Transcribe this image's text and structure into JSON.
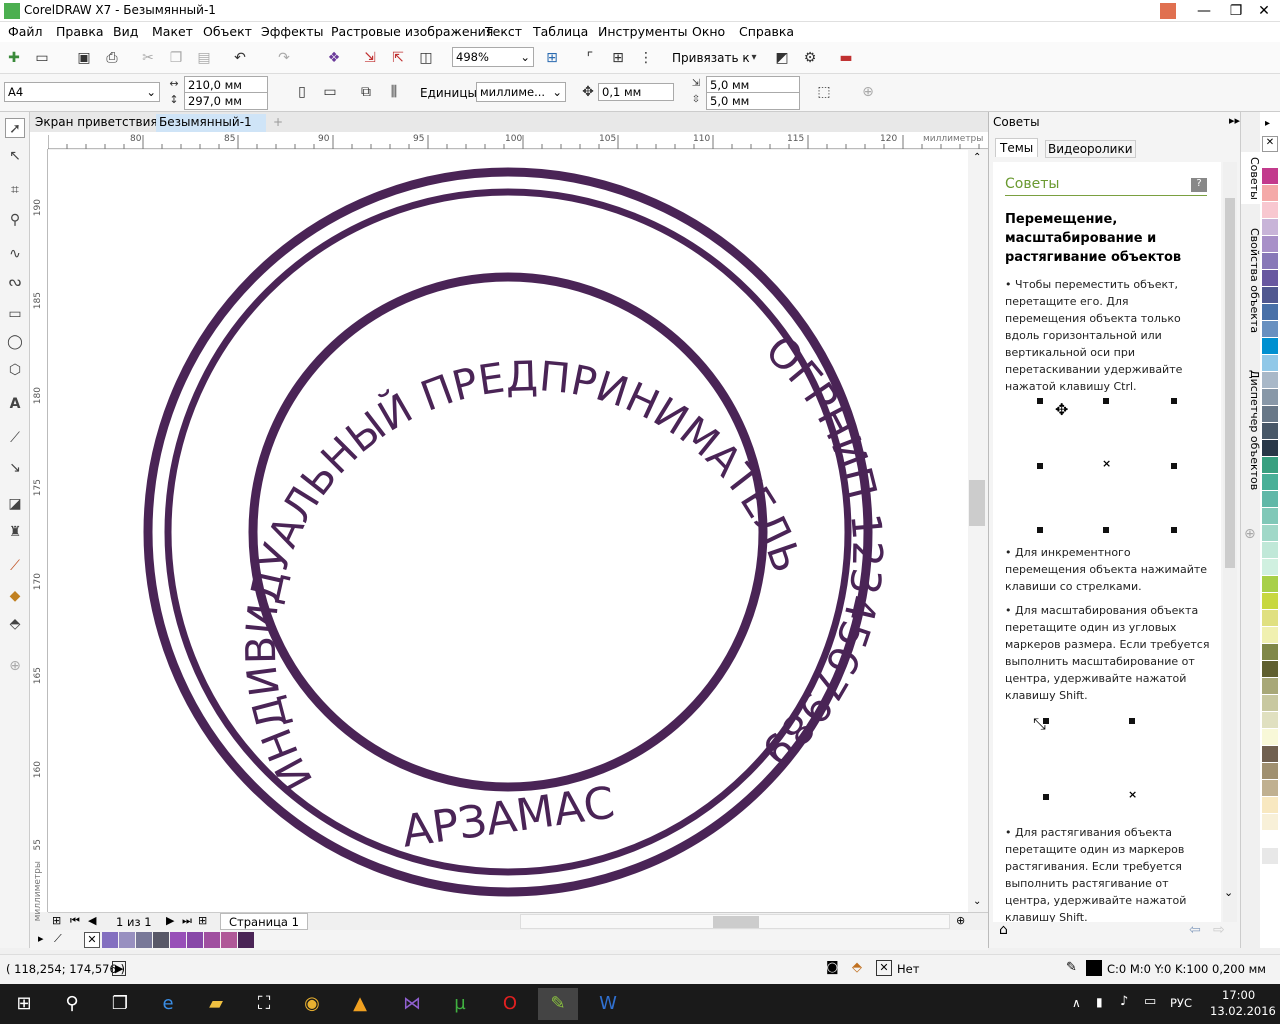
{
  "window": {
    "title": "CorelDRAW X7 - Безымянный-1",
    "minimize": "—",
    "restore": "❐",
    "close": "✕"
  },
  "menu": [
    "Файл",
    "Правка",
    "Вид",
    "Макет",
    "Объект",
    "Эффекты",
    "Растровые изображения",
    "Текст",
    "Таблица",
    "Инструменты",
    "Окно",
    "Справка"
  ],
  "toolbar": {
    "zoom_value": "498%",
    "snap_label": "Привязать к"
  },
  "propbar": {
    "page_size": "A4",
    "width": "210,0 мм",
    "height": "297,0 мм",
    "units_label": "Единицы:",
    "units_value": "миллиме...",
    "nudge": "0,1 мм",
    "dup_x": "5,0 мм",
    "dup_y": "5,0 мм"
  },
  "doc_tabs": [
    "Экран приветствия",
    "Безымянный-1"
  ],
  "ruler": {
    "h_ticks": [
      "80",
      "85",
      "90",
      "95",
      "100",
      "105",
      "110",
      "115",
      "120"
    ],
    "h_unit": "миллиметры",
    "v_ticks": [
      "190",
      "185",
      "180",
      "175",
      "170",
      "165",
      "160",
      "55"
    ],
    "v_unit": "миллиметры"
  },
  "stamp": {
    "outer_text": "ИНДИВИДУАЛЬНЫЙ ПРЕДПРИНИМАТЕЛЬ",
    "right_text": "ОГРНИП 1234567989",
    "bottom_text": "АРЗАМАС",
    "color": "#4a2456"
  },
  "pagebar": {
    "page_counter": "1 из 1",
    "page_tab": "Страница 1"
  },
  "status": {
    "coords": "( 118,254; 174,576 )",
    "fill_label": "Нет",
    "outline_info": "C:0 M:0 Y:0 K:100  0,200 мм"
  },
  "docker": {
    "header": "Советы",
    "tabs": [
      "Темы",
      "Видеоролики"
    ],
    "section_title": "Советы",
    "heading": "Перемещение, масштабирование и растягивание объектов",
    "p1": "Чтобы переместить объект, перетащите его. Для перемещения объекта только вдоль горизонтальной или вертикальной оси при перетаскивании удерживайте нажатой клавишу Ctrl.",
    "p2": "Для инкрементного перемещения объекта нажимайте клавиши со стрелками.",
    "p3": "Для масштабирования объекта перетащите один из угловых маркеров размера. Если требуется выполнить масштабирование от центра, удерживайте нажатой клавишу Shift.",
    "p4": "Для растягивания объекта перетащите один из маркеров растягивания. Если требуется выполнить растягивание от центра, удерживайте нажатой клавишу Shift."
  },
  "side_tabs": [
    "Советы",
    "Свойства объекта",
    "Диспетчер объектов"
  ],
  "palette_colors": [
    "#c23a8c",
    "#f4a9a8",
    "#f8c7d0",
    "#c8b4d8",
    "#a890c8",
    "#8878b8",
    "#6858a0",
    "#505890",
    "#4870a8",
    "#6890c0",
    "#0090d0",
    "#90c8e8",
    "#a8b8c8",
    "#8898a8",
    "#687888",
    "#485868",
    "#283848",
    "#38a080",
    "#48b098",
    "#60b8a8",
    "#80c8b8",
    "#a0d8c8",
    "#c0e8d8",
    "#d0f0e0",
    "#a8d048",
    "#c8d840",
    "#e0e080",
    "#f0f0b0",
    "#808848",
    "#606030",
    "#a8a878",
    "#c8c8a0",
    "#e0e0c0",
    "#f8f8d8",
    "#706050",
    "#a09070",
    "#c0b090",
    "#f8e8c0",
    "#f8f0d8",
    "#ffffff",
    "#e8e8e8"
  ],
  "bottom_palette": [
    "#8470c0",
    "#9890c0",
    "#787898",
    "#585868",
    "#9850b8",
    "#8848a8",
    "#a050a0",
    "#b05898",
    "#4a2456"
  ],
  "taskbar": {
    "lang": "РУС",
    "time": "17:00",
    "date": "13.02.2016"
  }
}
